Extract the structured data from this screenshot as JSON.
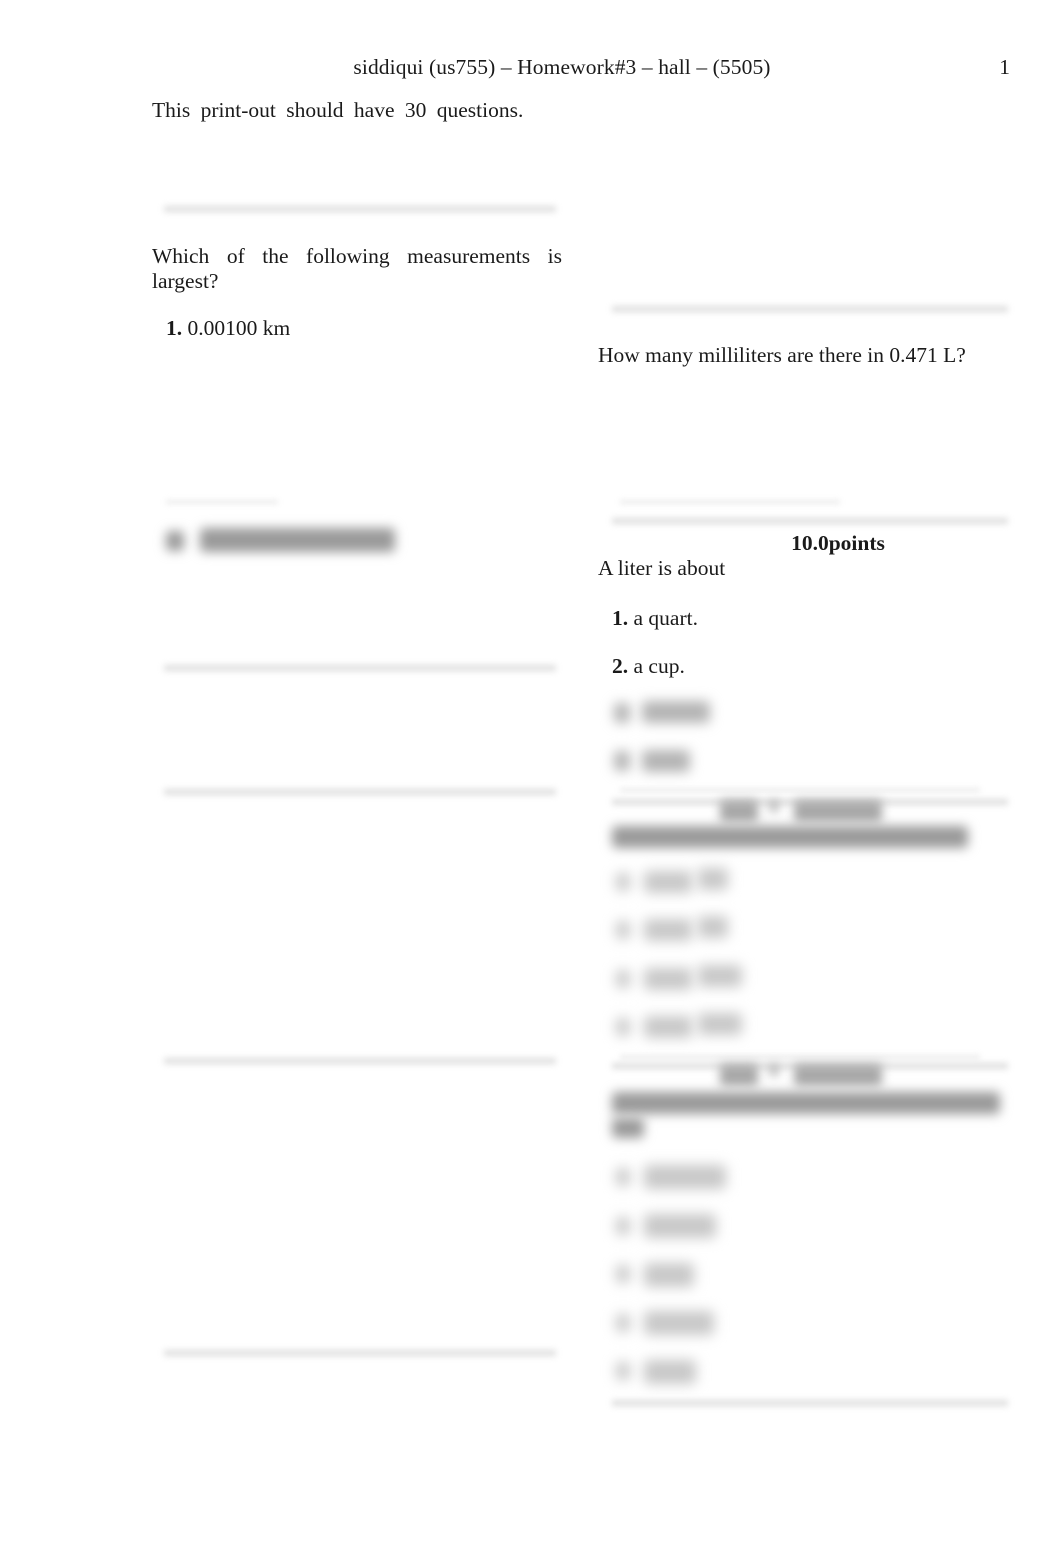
{
  "document": {
    "header_title": "siddiqui (us755) – Homework#3 – hall – (5505)",
    "page_number": "1",
    "intro": "This print-out should have 30 questions."
  },
  "left_column": {
    "question_1": {
      "prompt": "Which of the following measurements is largest?",
      "choices": [
        {
          "num": "1.",
          "text": "0.00100 km"
        }
      ]
    },
    "question_2_redacted": {
      "visible_text": "",
      "note": "redacted"
    }
  },
  "right_column": {
    "question_a": {
      "prompt": "How many milliliters are there in 0.471 L?"
    },
    "question_b": {
      "points": "10.0points",
      "prompt": "A liter is about",
      "choices": [
        {
          "num": "1.",
          "text": "a quart."
        },
        {
          "num": "2.",
          "text": "a cup."
        }
      ]
    },
    "question_c_redacted": {
      "visible_text": "",
      "note": "redacted"
    },
    "question_d_redacted": {
      "visible_text": "",
      "note": "redacted"
    }
  },
  "colors": {
    "page_background": "#ffffff",
    "text": "#1a1a1a",
    "rule": "#dcdcdc",
    "redaction": "#9a9a9a"
  }
}
